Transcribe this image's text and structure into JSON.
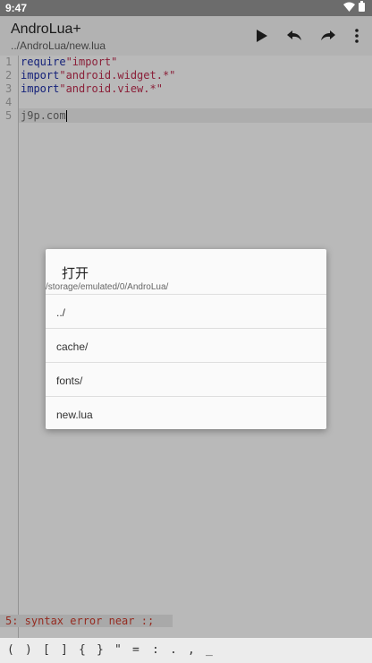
{
  "status_bar": {
    "time": "9:47"
  },
  "app_bar": {
    "title": "AndroLua+",
    "subtitle": "../AndroLua/new.lua"
  },
  "editor": {
    "lines": [
      {
        "num": "1",
        "tokens": [
          {
            "t": "require",
            "c": "kw"
          },
          {
            "t": "\"import\"",
            "c": "str"
          }
        ]
      },
      {
        "num": "2",
        "tokens": [
          {
            "t": "import",
            "c": "kw"
          },
          {
            "t": "\"android.widget.*\"",
            "c": "str"
          }
        ]
      },
      {
        "num": "3",
        "tokens": [
          {
            "t": "import",
            "c": "kw"
          },
          {
            "t": "\"android.view.*\"",
            "c": "str"
          }
        ]
      },
      {
        "num": "4",
        "tokens": []
      },
      {
        "num": "5",
        "tokens": [
          {
            "t": "j9p",
            "c": "plain"
          },
          {
            "t": ".com",
            "c": "plain"
          }
        ]
      }
    ],
    "error_message": "5: syntax error near :;"
  },
  "dialog": {
    "title": "打开",
    "path": "/storage/emulated/0/AndroLua/",
    "items": [
      "../",
      "cache/",
      "fonts/",
      "new.lua"
    ]
  },
  "symbol_bar": [
    "(",
    ")",
    "[",
    "]",
    "{",
    "}",
    "\"",
    "=",
    ":",
    ".",
    ",",
    "_"
  ]
}
